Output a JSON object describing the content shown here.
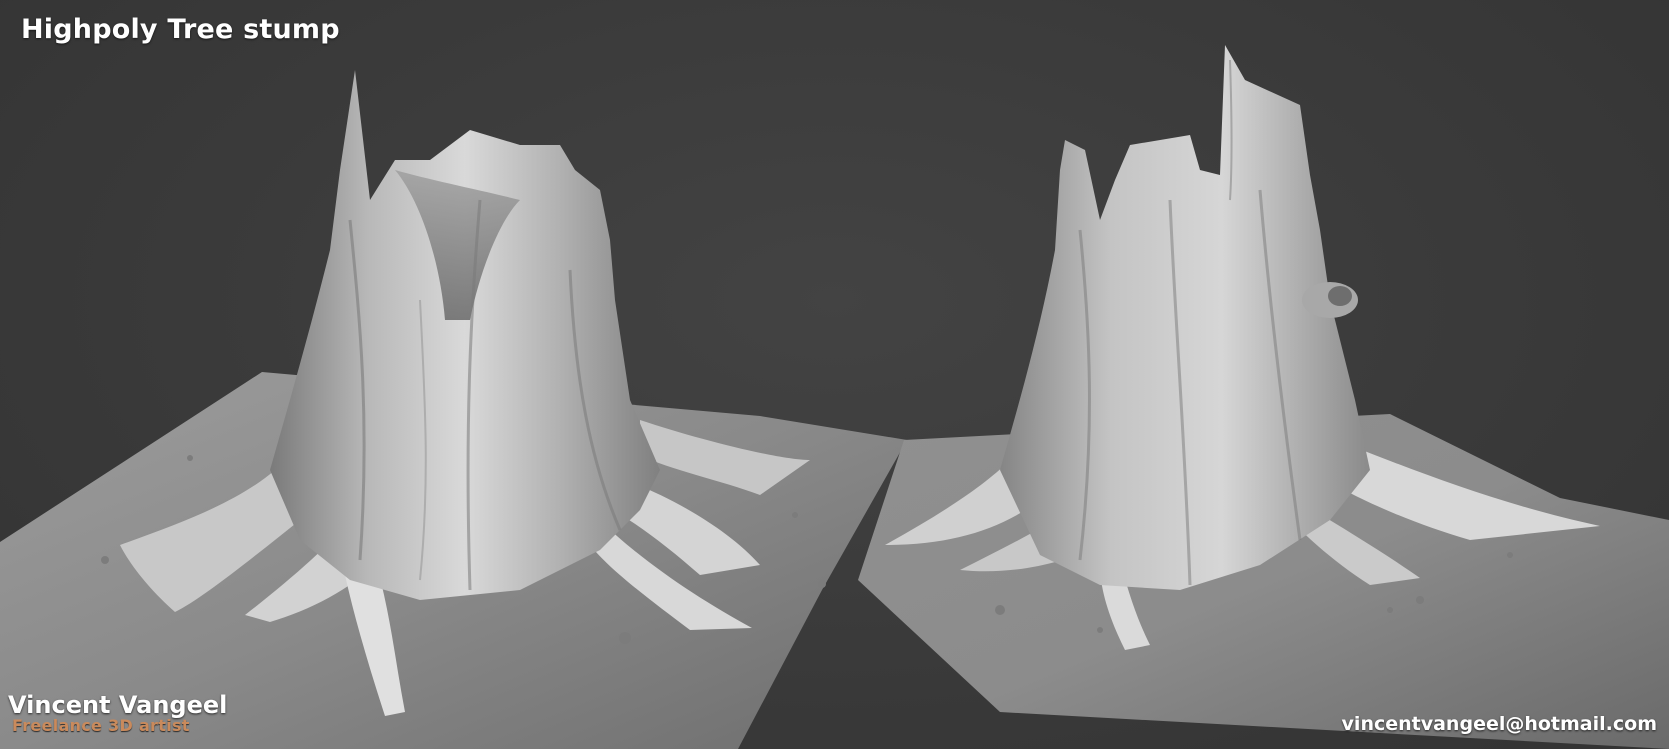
{
  "title": "Highpoly Tree stump",
  "author": {
    "name": "Vincent Vangeel",
    "role": "Freelance 3D artist"
  },
  "contact": {
    "email": "vincentvangeel@hotmail.com"
  },
  "colors": {
    "background": "#3a3a3a",
    "title_text": "#ffffff",
    "role_text": "#c98a5c",
    "model_light": "#e6e6e6",
    "model_dark": "#6a6a6a"
  },
  "renders": [
    {
      "subject": "tree-stump",
      "view": "front"
    },
    {
      "subject": "tree-stump",
      "view": "back"
    }
  ]
}
